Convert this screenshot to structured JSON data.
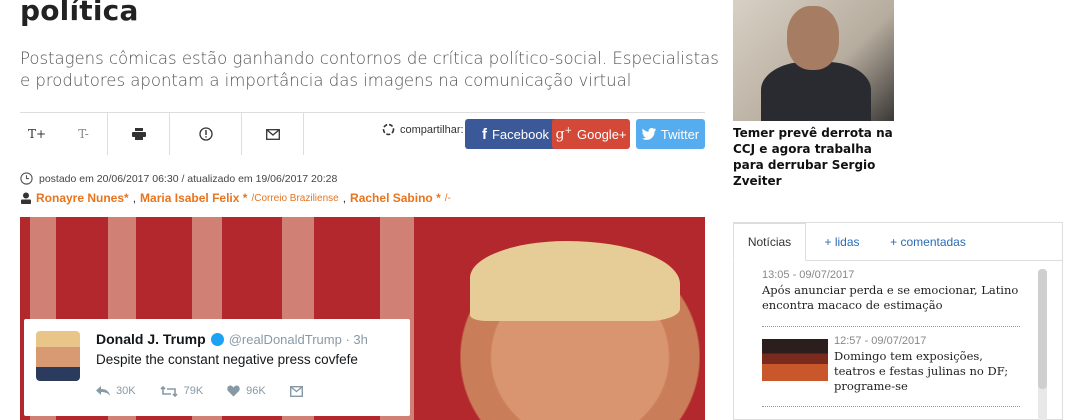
{
  "article": {
    "headline_tail": "política",
    "subtitle": "Postagens cômicas estão ganhando contornos de crítica político-social. Especialistas e produtores apontam a importância das imagens na comunicação virtual",
    "toolbar": {
      "font_increase": "T+",
      "font_decrease": "T-",
      "share_label": "compartilhar:",
      "facebook": "Facebook",
      "google_plus": "Google+",
      "twitter": "Twitter"
    },
    "meta": "postado em 20/06/2017 06:30 / atualizado em 19/06/2017 20:28",
    "authors": [
      {
        "name": "Ronayre Nunes*",
        "sep": ","
      },
      {
        "name": "Maria Isabel Felix *",
        "source": "/Correio Braziliense",
        "sep": ","
      },
      {
        "name": "Rachel Sabino *",
        "source": "/-"
      }
    ],
    "hero_tweet": {
      "name": "Donald J. Trump",
      "handle": "@realDonaldTrump · 3h",
      "text": "Despite the constant negative press covfefe",
      "replies": "30K",
      "retweets": "79K",
      "likes": "96K"
    }
  },
  "sidebar": {
    "featured_caption": "Temer prevê derrota na CCJ e agora trabalha para derrubar Sergio Zveiter",
    "tabs": [
      "Notícias",
      "+ lidas",
      "+ comentadas"
    ],
    "news": [
      {
        "time": "13:05 - 09/07/2017",
        "title": "Após anunciar perda e se emocionar, Latino encontra macaco de estimação"
      },
      {
        "time": "12:57 - 09/07/2017",
        "title": "Domingo tem exposições, teatros e festas julinas no DF; programe-se"
      }
    ]
  },
  "colors": {
    "accent_orange": "#e8741e",
    "facebook": "#3b5998",
    "google_plus": "#d34836",
    "twitter": "#55acee",
    "link_blue": "#2a6db5"
  }
}
